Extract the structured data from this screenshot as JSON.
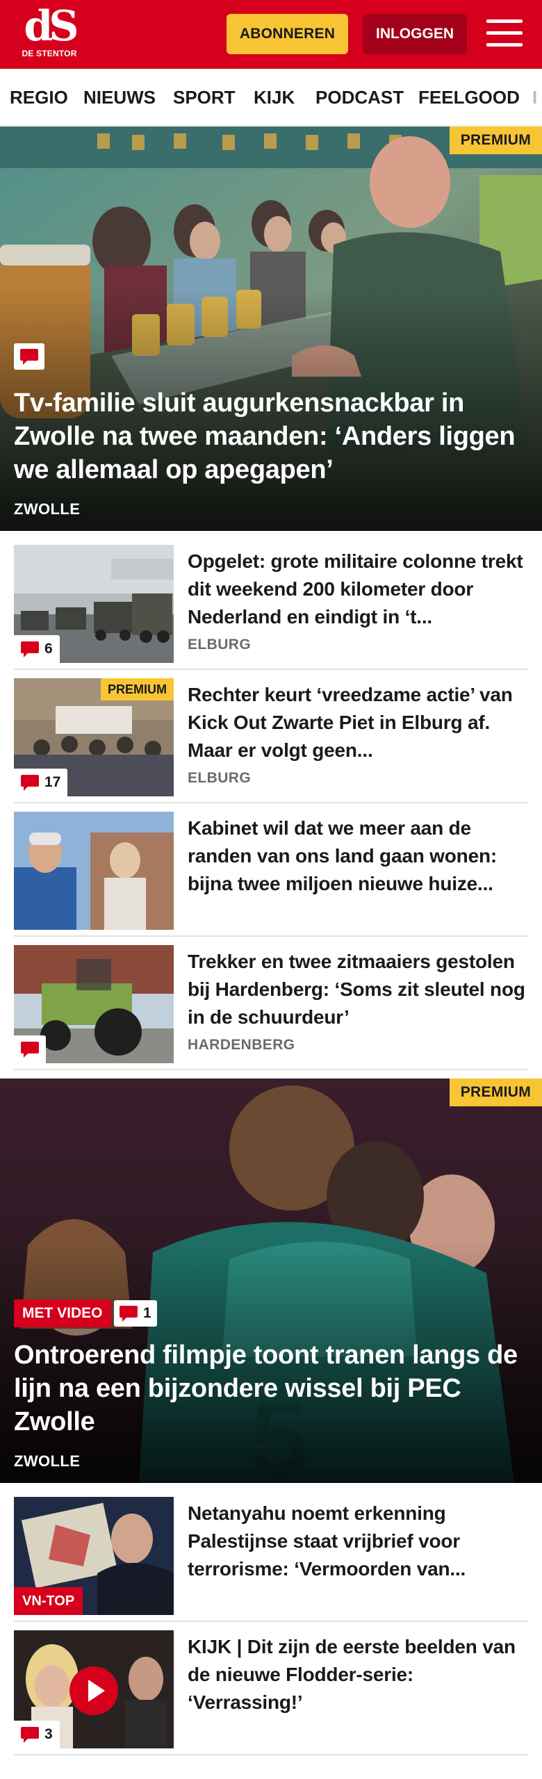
{
  "header": {
    "logo_mark": "dS",
    "logo_sub": "DE STENTOR",
    "subscribe_label": "ABONNEREN",
    "login_label": "INLOGGEN",
    "menu_icon": "hamburger-menu-icon",
    "brand_color": "#d6001c"
  },
  "nav": {
    "items": [
      "REGIO",
      "NIEUWS",
      "SPORT",
      "KIJK",
      "PODCAST",
      "FEELGOOD",
      "I"
    ]
  },
  "hero1": {
    "badge": "PREMIUM",
    "title": "Tv-familie sluit augurkensnackbar in Zwolle na twee maanden: ‘Anders liggen we allemaal op apegapen’",
    "location": "ZWOLLE",
    "comment_icon": "comment-icon"
  },
  "list1": [
    {
      "title": "Opgelet: grote militaire colonne trekt dit weekend 200 kilometer door Nederland en eindigt in ‘t...",
      "location": "ELBURG",
      "comments": "6"
    },
    {
      "title": "Rechter keurt ‘vreedzame actie’ van Kick Out Zwarte Piet in Elburg af. Maar er volgt geen...",
      "location": "ELBURG",
      "comments": "17",
      "badge": "PREMIUM"
    },
    {
      "title": "Kabinet wil dat we meer aan de randen van ons land gaan wonen: bijna twee miljoen nieuwe huize...",
      "location": ""
    },
    {
      "title": "Trekker en twee zitmaaiers gestolen bij Hardenberg: ‘Soms zit sleutel nog in de schuurdeur’",
      "location": "HARDENBERG",
      "comments": ""
    }
  ],
  "hero2": {
    "badge": "PREMIUM",
    "video_tag": "MET VIDEO",
    "comments": "1",
    "title": "Ontroerend filmpje toont tranen langs de lijn na een bijzondere wissel bij PEC Zwolle",
    "location": "ZWOLLE"
  },
  "list2": [
    {
      "title": "Netanyahu noemt erkenning Palestijnse staat vrijbrief voor terrorisme: ‘Vermoorden van...",
      "tag": "VN-TOP"
    },
    {
      "title": "KIJK | Dit zijn de eerste beelden van de nieuwe Flodder-serie: ‘Verrassing!’",
      "comments": "3",
      "play_icon": "play-icon"
    }
  ],
  "colors": {
    "accent": "#d6001c",
    "premium": "#f8c534",
    "login": "#a3001a",
    "location_grey": "#6b6b6b"
  }
}
